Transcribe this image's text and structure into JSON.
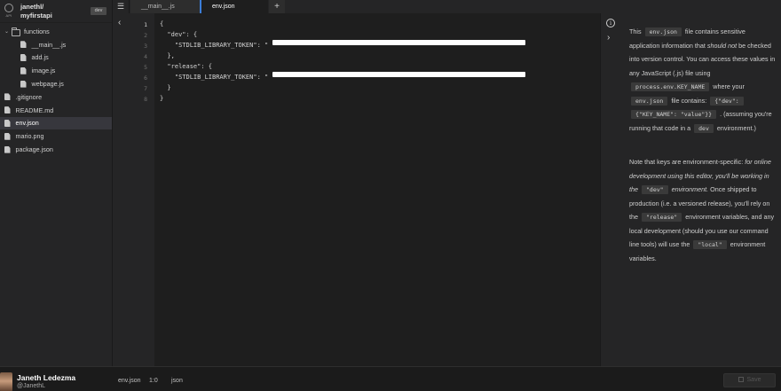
{
  "project": {
    "logo_text": "API",
    "user_path": "janethl/",
    "name": "myfirstapi",
    "env_badge": "dev"
  },
  "tree": [
    {
      "label": "functions",
      "type": "folder",
      "indent": 0,
      "caret": "⌄"
    },
    {
      "label": "__main__.js",
      "type": "file",
      "indent": 1
    },
    {
      "label": "add.js",
      "type": "file",
      "indent": 1
    },
    {
      "label": "image.js",
      "type": "file",
      "indent": 1
    },
    {
      "label": "webpage.js",
      "type": "file",
      "indent": 1
    },
    {
      "label": ".gitignore",
      "type": "file",
      "indent": 0
    },
    {
      "label": "README.md",
      "type": "file",
      "indent": 0
    },
    {
      "label": "env.json",
      "type": "file",
      "indent": 0,
      "active": true
    },
    {
      "label": "mario.png",
      "type": "file",
      "indent": 0
    },
    {
      "label": "package.json",
      "type": "file",
      "indent": 0
    }
  ],
  "tabs": {
    "main": "__main__.js",
    "env": "env.json",
    "add": "+"
  },
  "editor": {
    "lines": [
      {
        "n": "1",
        "text": "{"
      },
      {
        "n": "2",
        "text": "  \"dev\": {"
      },
      {
        "n": "3",
        "text": "    \"STDLIB_LIBRARY_TOKEN\": \""
      },
      {
        "n": "4",
        "text": "  },"
      },
      {
        "n": "5",
        "text": "  \"release\": {"
      },
      {
        "n": "6",
        "text": "    \"STDLIB_LIBRARY_TOKEN\": \""
      },
      {
        "n": "7",
        "text": "  }"
      },
      {
        "n": "8",
        "text": "}"
      }
    ]
  },
  "info": {
    "p1": {
      "a": "This",
      "chip1": "env.json",
      "b": "file contains sensitive application information that",
      "em1": "should not",
      "c": "be checked into version control. You can access these values in any JavaScript (.js) file using",
      "chip2": "process.env.KEY_NAME",
      "d": "where your",
      "chip3": "env.json",
      "e": "file contains:",
      "chip4": "{\"dev\":",
      "chip5": "{\"KEY_NAME\": \"value\"}}",
      "f": ". (assuming you're running that code in a",
      "chip6": "dev",
      "g": "environment.)"
    },
    "p2": {
      "a": "Note that keys are environment-specific:",
      "em1": "for online development using this editor, you'll be working in the",
      "chip1": "\"dev\"",
      "em2": "environment.",
      "b": "Once shipped to production (i.e. a versioned release), you'll rely on the",
      "chip2": "\"release\"",
      "c": "environment variables, and any local development (should you use our command line tools) will use the",
      "chip3": "\"local\"",
      "d": "environment variables."
    }
  },
  "status": {
    "file": "env.json",
    "position": "1:0",
    "language": "json"
  },
  "user": {
    "name": "Janeth Ledezma",
    "handle": "@JanethL"
  },
  "save_label": "Save",
  "colors": {
    "accent": "#3b7dd8",
    "background": "#1e1e1e",
    "sidebar": "#252526"
  }
}
